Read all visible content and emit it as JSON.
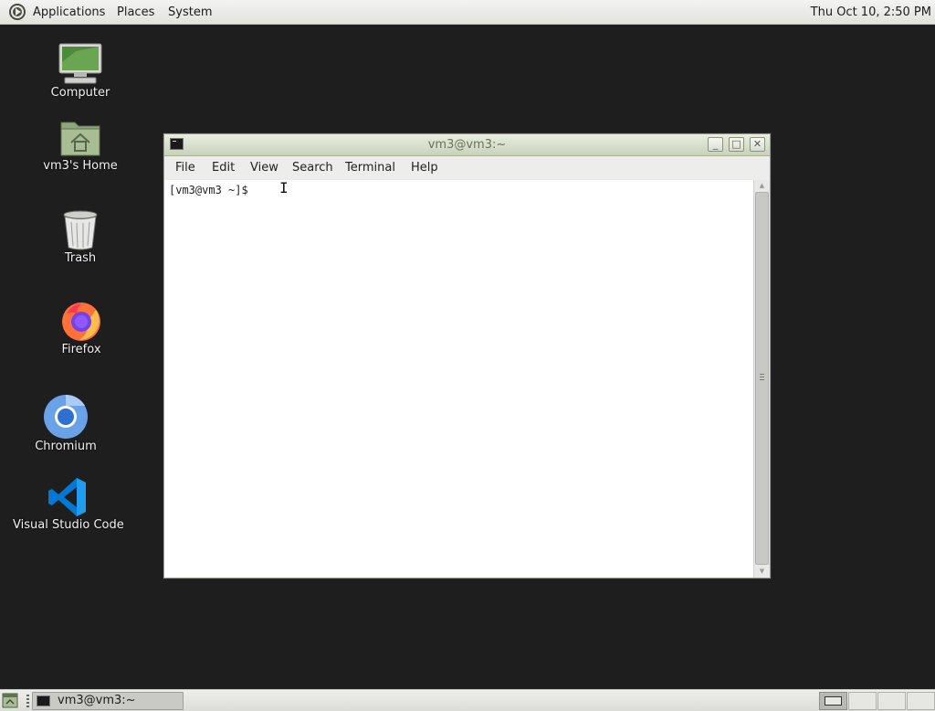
{
  "top_panel": {
    "menus": [
      "Applications",
      "Places",
      "System"
    ],
    "clock": "Thu Oct 10,  2:50 PM"
  },
  "desktop_icons": [
    {
      "label": "Computer",
      "icon": "computer-icon"
    },
    {
      "label": "vm3's Home",
      "icon": "home-folder-icon"
    },
    {
      "label": "Trash",
      "icon": "trash-icon"
    },
    {
      "label": "Firefox",
      "icon": "firefox-icon"
    },
    {
      "label": "Chromium",
      "icon": "chromium-icon"
    },
    {
      "label": "Visual Studio Code",
      "icon": "vscode-icon"
    }
  ],
  "terminal": {
    "title": "vm3@vm3:~",
    "menu": [
      "File",
      "Edit",
      "View",
      "Search",
      "Terminal",
      "Help"
    ],
    "prompt": "[vm3@vm3 ~]$ ",
    "ibeam": "I"
  },
  "window_buttons": {
    "minimize": "_",
    "maximize": "□",
    "close": "✕"
  },
  "taskbar": {
    "task_label": "vm3@vm3:~",
    "workspaces": 4,
    "active_workspace": 1
  },
  "colors": {
    "desktop": "#1e1e1e",
    "titlebar": "#c9d1bb",
    "panel": "#e6e6e3"
  }
}
